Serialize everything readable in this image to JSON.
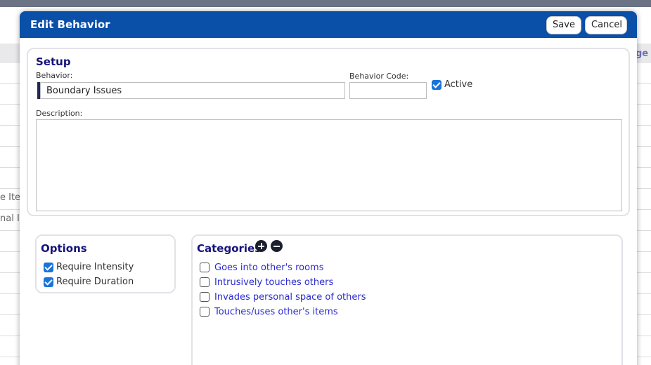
{
  "background": {
    "header_fragment": "ge",
    "row_fragments": [
      "e Ite",
      "nal I"
    ]
  },
  "dialog": {
    "title": "Edit Behavior",
    "save_label": "Save",
    "cancel_label": "Cancel"
  },
  "setup": {
    "title": "Setup",
    "behavior_label": "Behavior:",
    "behavior_value": "Boundary Issues",
    "code_label": "Behavior Code:",
    "code_value": "",
    "active_label": "Active",
    "active_checked": true,
    "description_label": "Description:",
    "description_value": ""
  },
  "options": {
    "title": "Options",
    "items": [
      {
        "label": "Require Intensity",
        "checked": true
      },
      {
        "label": "Require Duration",
        "checked": true
      }
    ]
  },
  "categories": {
    "title": "Categories",
    "add_icon": "plus-circle-icon",
    "remove_icon": "minus-circle-icon",
    "items": [
      {
        "label": "Goes into other's rooms",
        "checked": false
      },
      {
        "label": "Intrusively touches others",
        "checked": false
      },
      {
        "label": "Invades personal space of others",
        "checked": false
      },
      {
        "label": "Touches/uses other's items",
        "checked": false
      }
    ]
  },
  "colors": {
    "titlebar": "#0a4fa8",
    "heading": "#15127a",
    "link": "#2b2bd0",
    "checkbox": "#1a73d8"
  }
}
